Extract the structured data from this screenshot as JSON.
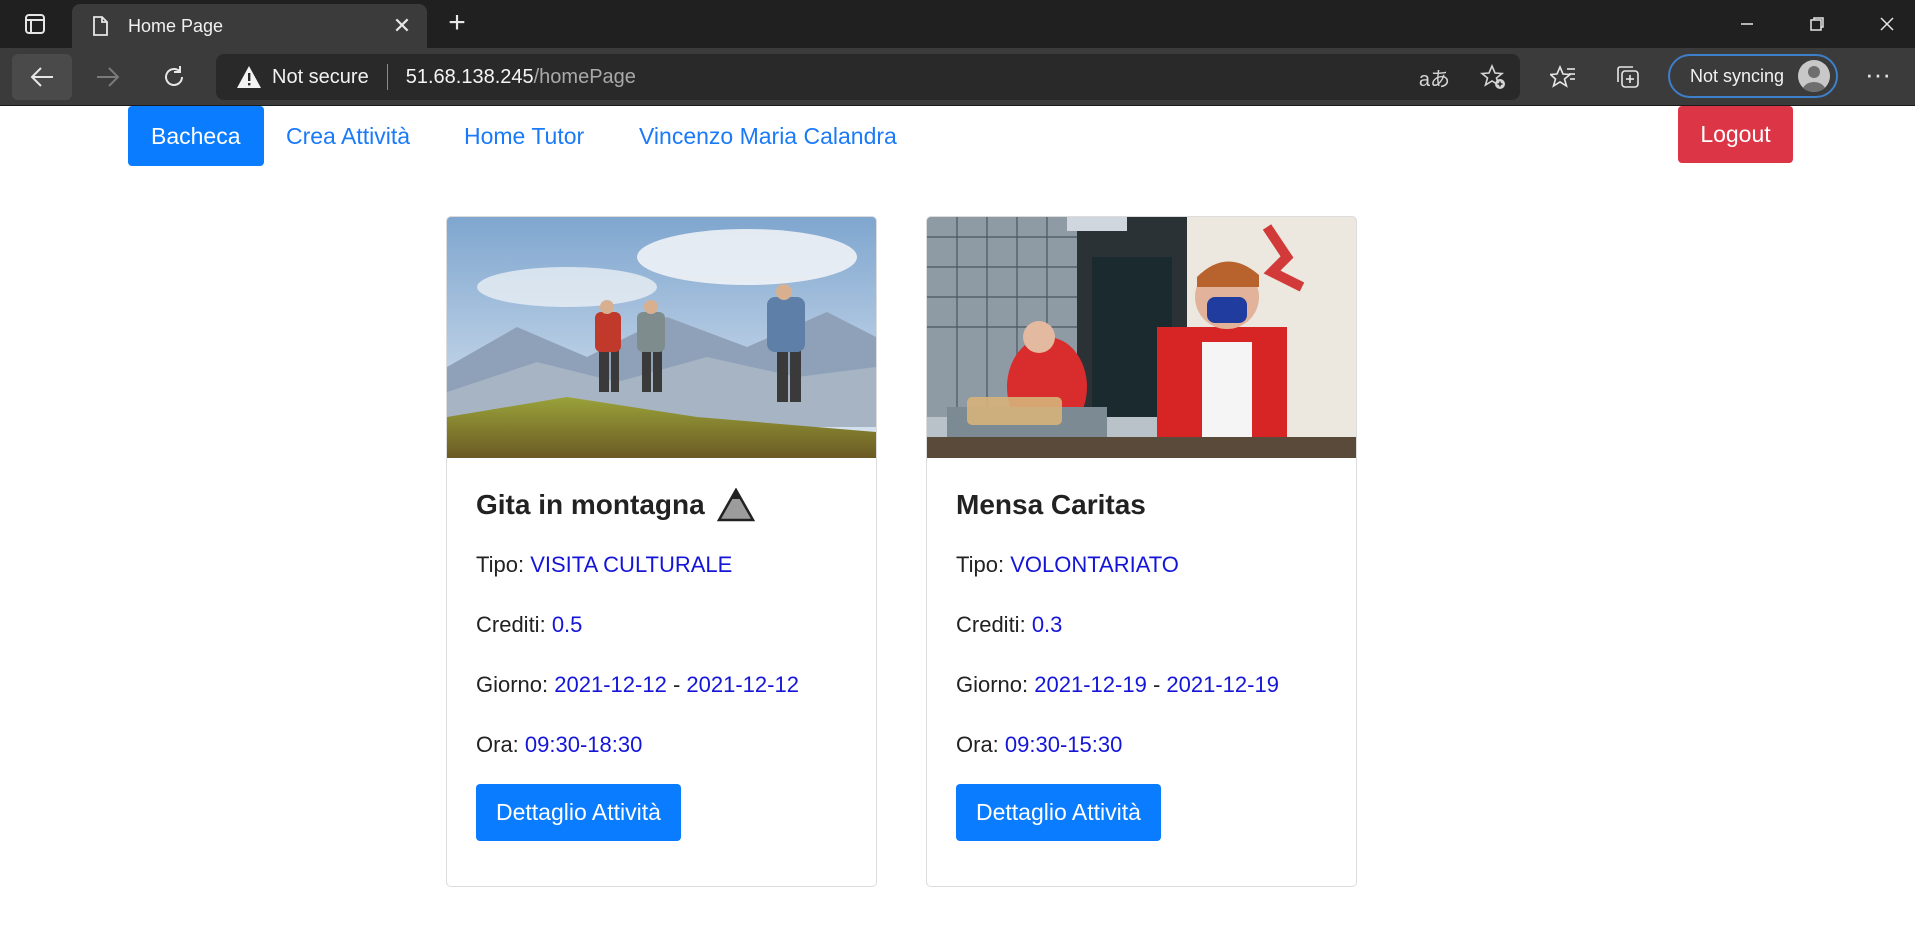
{
  "browser": {
    "tab_title": "Home Page",
    "security_label": "Not secure",
    "url_host": "51.68.138.245",
    "url_path": "/homePage",
    "sync_label": "Not syncing"
  },
  "nav": {
    "items": [
      {
        "label": "Bacheca",
        "active": true
      },
      {
        "label": "Crea Attività",
        "active": false
      },
      {
        "label": "Home Tutor",
        "active": false
      },
      {
        "label": "Vincenzo Maria Calandra",
        "active": false
      }
    ],
    "logout_label": "Logout"
  },
  "cards": [
    {
      "title": "Gita in montagna",
      "tipo_label": "Tipo:",
      "tipo": "VISITA CULTURALE",
      "crediti_label": "Crediti:",
      "crediti": "0.5",
      "giorno_label": "Giorno:",
      "giorno_start": "2021-12-12",
      "giorno_sep": "-",
      "giorno_end": "2021-12-12",
      "ora_label": "Ora:",
      "ora": "09:30-18:30",
      "button_label": "Dettaglio Attività"
    },
    {
      "title": "Mensa Caritas",
      "tipo_label": "Tipo:",
      "tipo": "VOLONTARIATO",
      "crediti_label": "Crediti:",
      "crediti": "0.3",
      "giorno_label": "Giorno:",
      "giorno_start": "2021-12-19",
      "giorno_sep": "-",
      "giorno_end": "2021-12-19",
      "ora_label": "Ora:",
      "ora": "09:30-15:30",
      "button_label": "Dettaglio Attività"
    }
  ],
  "colors": {
    "primary": "#0a7cff",
    "danger": "#dc3545",
    "value_text": "#1515d8"
  }
}
